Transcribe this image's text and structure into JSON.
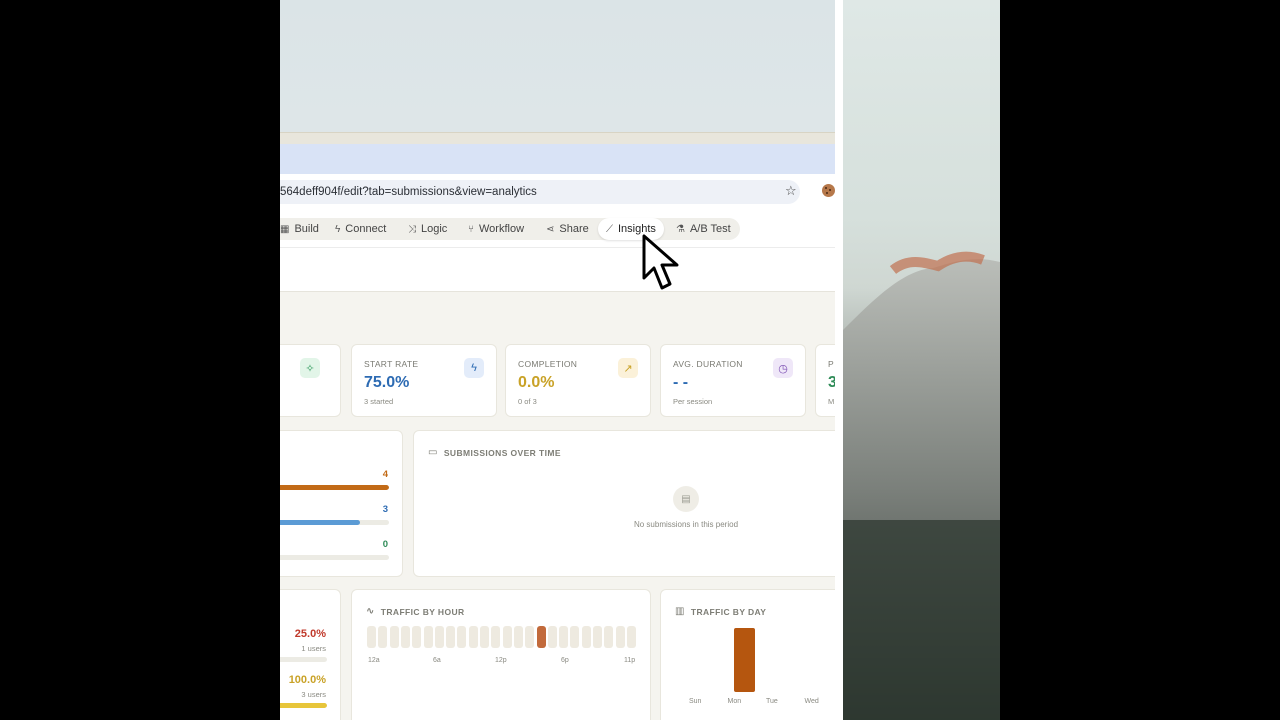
{
  "browser": {
    "url": "564deff904f/edit?tab=submissions&view=analytics"
  },
  "nav": {
    "items": [
      {
        "label": "Build",
        "icon": "grid-icon"
      },
      {
        "label": "Connect",
        "icon": "plug-icon"
      },
      {
        "label": "Logic",
        "icon": "shuffle-icon"
      },
      {
        "label": "Workflow",
        "icon": "branch-icon"
      },
      {
        "label": "Share",
        "icon": "share-icon"
      },
      {
        "label": "Insights",
        "icon": "chart-line-icon",
        "active": true
      },
      {
        "label": "A/B Test",
        "icon": "flask-icon"
      }
    ]
  },
  "stats": {
    "start_rate": {
      "label": "START RATE",
      "value": "75.0%",
      "sub": "3 started",
      "color": "#2d6bb3"
    },
    "completion": {
      "label": "COMPLETION",
      "value": "0.0%",
      "sub": "0 of 3",
      "color": "#c9a227"
    },
    "avg_duration": {
      "label": "AVG. DURATION",
      "value": "- -",
      "sub": "Per session",
      "color": "#2d6bb3"
    },
    "partial": {
      "label": "P",
      "value": "3",
      "sub": "M",
      "color": "#2e8b57"
    }
  },
  "funnel": {
    "rows": [
      {
        "value": "4",
        "fill": 1.0,
        "color": "#c26a16"
      },
      {
        "value": "3",
        "fill": 0.75,
        "color": "#5b9bd5"
      },
      {
        "value": "0",
        "fill": 0.0,
        "color": "#2e8b57"
      }
    ]
  },
  "submissions_over_time": {
    "title": "SUBMISSIONS OVER TIME",
    "empty": "No submissions in this period"
  },
  "devices": {
    "rows": [
      {
        "pct": "25.0%",
        "users": "1 users",
        "fill": 0.25,
        "color": "#c0392b",
        "bar_color": "#ecebe4"
      },
      {
        "pct": "100.0%",
        "users": "3 users",
        "fill": 1.0,
        "color": "#c9a227",
        "bar_color": "#e7c53a"
      }
    ]
  },
  "traffic_by_hour": {
    "title": "TRAFFIC BY HOUR",
    "hot_hour": 15,
    "ticks": [
      "12a",
      "6a",
      "12p",
      "6p",
      "11p"
    ]
  },
  "traffic_by_day": {
    "title": "TRAFFIC BY DAY",
    "days": [
      "Sun",
      "Mon",
      "Tue",
      "Wed"
    ],
    "values": [
      0,
      3,
      0,
      0
    ],
    "bar_color": "#b5560f"
  }
}
